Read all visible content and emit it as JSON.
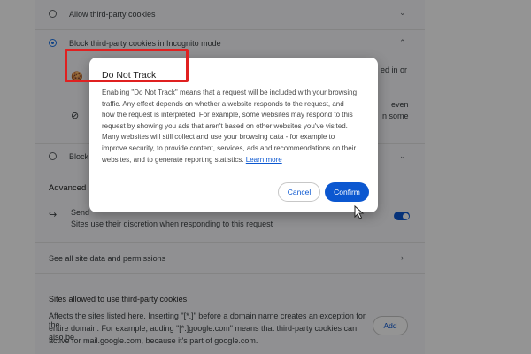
{
  "settings": {
    "allow_third_party": "Allow third-party cookies",
    "block_incognito": "Block third-party cookies in Incognito mode",
    "right_text_1": "ed in or",
    "right_text_2": "even",
    "right_text_3": "n some",
    "block_all_partial": "Block",
    "advanced_heading": "Advanced",
    "dnt_partial": "Send",
    "dnt_desc": "Sites use their discretion when responding to this request",
    "see_all": "See all site data and permissions",
    "sites_allowed_heading": "Sites allowed to use third-party cookies",
    "sites_allowed_desc_1": "Affects the sites listed here. Inserting \"[*.]\" before a domain name creates an exception for the",
    "sites_allowed_desc_2": "entire domain. For example, adding \"[*.]google.com\" means that third-party cookies can also be",
    "sites_allowed_desc_3": "active for mail.google.com, because it's part of google.com.",
    "add_label": "Add"
  },
  "dialog": {
    "title": "Do Not Track",
    "body_1": "Enabling \"Do Not Track\" means that a request will be included with your browsing",
    "body_2": "traffic. Any effect depends on whether a website responds to the request, and",
    "body_3": "how the request is interpreted. For example, some websites may respond to this",
    "body_4": "request by showing you ads that aren't based on other websites you've visited.",
    "body_5": "Many websites will still collect and use your browsing data - for example to",
    "body_6": "improve security, to provide content, services, ads and recommendations on their",
    "body_7": "websites, and to generate reporting statistics.",
    "learn_more": "Learn more",
    "cancel_label": "Cancel",
    "confirm_label": "Confirm"
  },
  "colors": {
    "accent": "#0b57d0",
    "highlight": "#e02020",
    "overlay": "rgba(0,0,0,0.42)"
  },
  "dnt_toggle_on": true
}
